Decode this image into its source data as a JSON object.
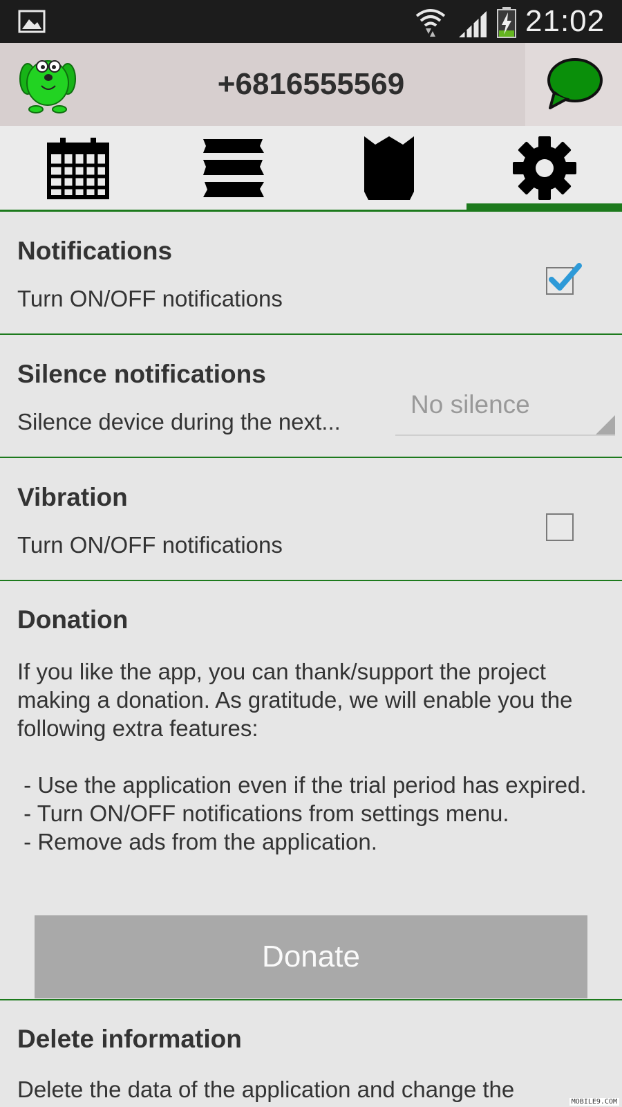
{
  "status_bar": {
    "time": "21:02",
    "icons": [
      "gallery-icon",
      "wifi-icon",
      "signal-icon",
      "battery-charging-icon"
    ]
  },
  "header": {
    "phone_number": "+6816555569",
    "logo_icon": "green-dog-icon",
    "chat_icon": "chat-bubble-icon",
    "accent_color": "#0a8f0a"
  },
  "tabs": [
    {
      "icon": "calendar-icon",
      "active": false
    },
    {
      "icon": "list-icon",
      "active": false
    },
    {
      "icon": "crown-icon",
      "active": false
    },
    {
      "icon": "gear-icon",
      "active": true
    }
  ],
  "settings": {
    "notifications": {
      "title": "Notifications",
      "subtitle": "Turn ON/OFF notifications",
      "checked": true
    },
    "silence": {
      "title": "Silence notifications",
      "subtitle": "Silence device during the next...",
      "selected": "No silence"
    },
    "vibration": {
      "title": "Vibration",
      "subtitle": "Turn ON/OFF notifications",
      "checked": false
    },
    "donation": {
      "title": "Donation",
      "body": "If you like the app, you can thank/support the project making a donation. As gratitude, we will enable you the following extra features:\n\n - Use the application even if the trial period has expired.\n - Turn ON/OFF notifications from settings menu.\n - Remove ads from the application.",
      "button_label": "Donate"
    },
    "delete": {
      "title": "Delete information",
      "body": "Delete the data of the application and change the"
    }
  },
  "watermark": "MOBILE9.COM",
  "colors": {
    "divider": "#1d7a1d",
    "checkbox_tick": "#2e9ad8",
    "button_bg": "#a9a9a9"
  }
}
